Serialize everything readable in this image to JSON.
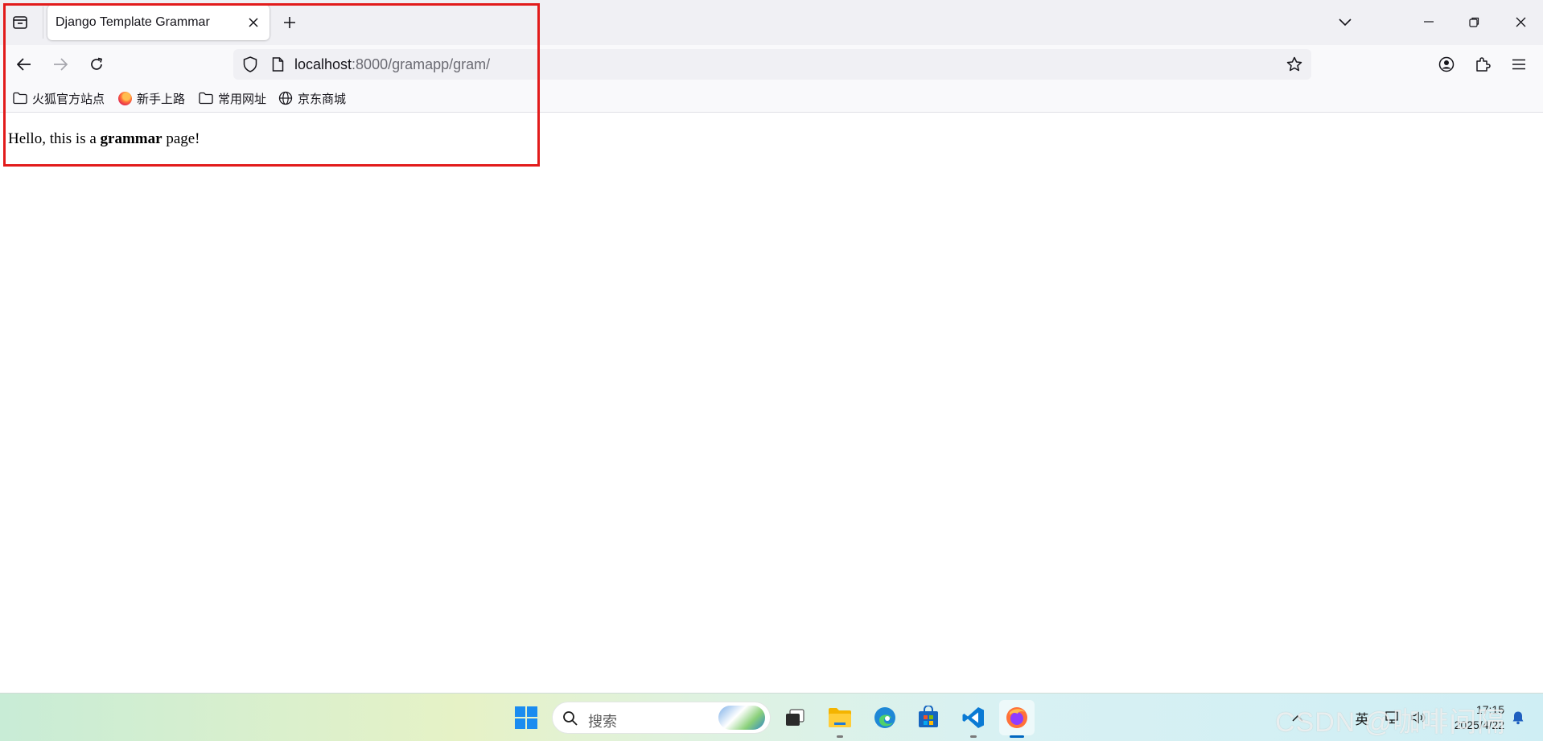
{
  "browser": {
    "tab": {
      "title": "Django Template Grammar"
    },
    "url": {
      "host": "localhost",
      "path": ":8000/gramapp/gram/"
    }
  },
  "bookmarks": [
    {
      "label": "火狐官方站点",
      "icon": "folder-icon"
    },
    {
      "label": "新手上路",
      "icon": "firefox-icon"
    },
    {
      "label": "常用网址",
      "icon": "folder-icon"
    },
    {
      "label": "京东商城",
      "icon": "globe-icon"
    }
  ],
  "page": {
    "text_before": "Hello, this is a ",
    "text_bold": "grammar",
    "text_after": " page!"
  },
  "taskbar": {
    "search_placeholder": "搜索",
    "ime_label": "英",
    "clock_time": "17:15",
    "clock_date": "2025/4/22"
  },
  "watermark": "CSDN @咖啡间隔",
  "colors": {
    "highlight_border": "#e21b1b",
    "accent": "#0067c0"
  }
}
